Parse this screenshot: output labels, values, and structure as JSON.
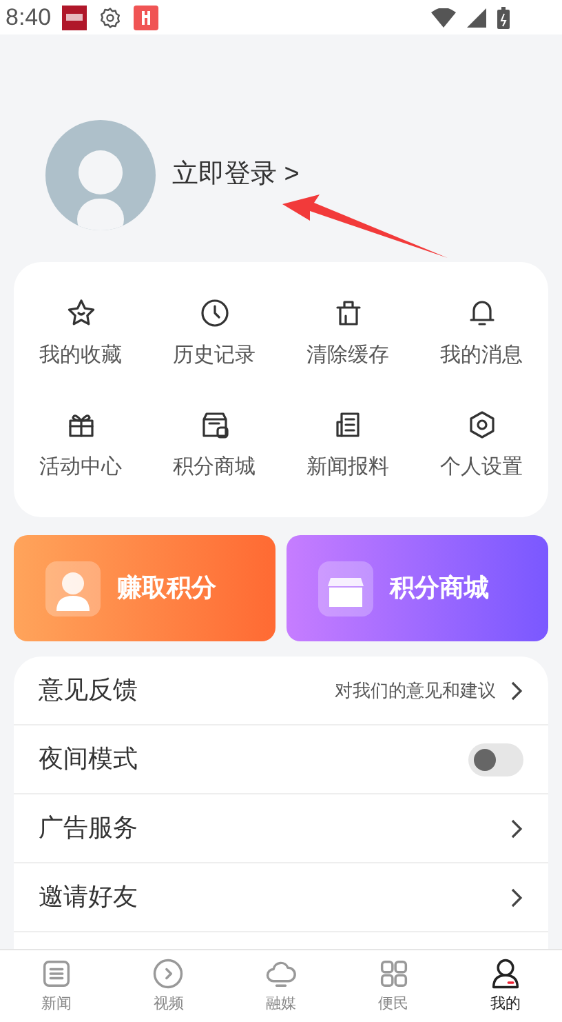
{
  "status_bar": {
    "time": "8:40"
  },
  "profile": {
    "login": "立即登录 >"
  },
  "shortcuts": [
    {
      "label": "我的收藏"
    },
    {
      "label": "历史记录"
    },
    {
      "label": "清除缓存"
    },
    {
      "label": "我的消息"
    },
    {
      "label": "活动中心"
    },
    {
      "label": "积分商城"
    },
    {
      "label": "新闻报料"
    },
    {
      "label": "个人设置"
    }
  ],
  "banners": [
    {
      "label": "赚取积分"
    },
    {
      "label": "积分商城"
    }
  ],
  "settings": [
    {
      "kind": "link",
      "label": "意见反馈",
      "hint": "对我们的意见和建议"
    },
    {
      "kind": "toggle",
      "label": "夜间模式",
      "on": false
    },
    {
      "kind": "link",
      "label": "广告服务"
    },
    {
      "kind": "link",
      "label": "邀请好友"
    }
  ],
  "tab_bar": [
    {
      "label": "新闻",
      "selected": false
    },
    {
      "label": "视频",
      "selected": false
    },
    {
      "label": "融媒",
      "selected": false
    },
    {
      "label": "便民",
      "selected": false
    },
    {
      "label": "我的",
      "selected": true
    }
  ]
}
